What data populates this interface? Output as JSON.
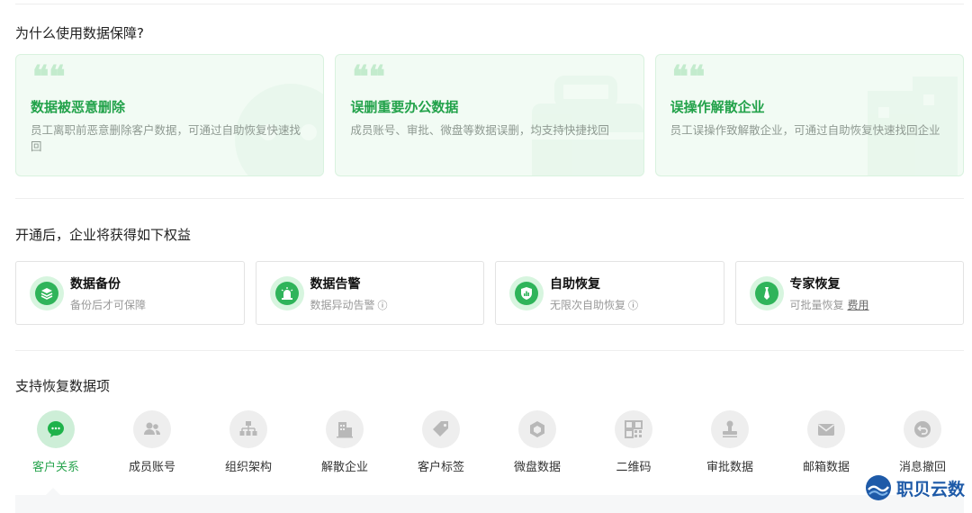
{
  "why": {
    "heading": "为什么使用数据保障?",
    "cards": [
      {
        "title": "数据被恶意删除",
        "desc": "员工离职前恶意删除客户数据，可通过自助恢复快速找回"
      },
      {
        "title": "误删重要办公数据",
        "desc": "成员账号、审批、微盘等数据误删，均支持快捷找回"
      },
      {
        "title": "误操作解散企业",
        "desc": "员工误操作致解散企业，可通过自助恢复快速找回企业"
      }
    ]
  },
  "benefits": {
    "heading": "开通后，企业将获得如下权益",
    "cards": [
      {
        "title": "数据备份",
        "desc": "备份后才可保障",
        "icon": "layers-icon"
      },
      {
        "title": "数据告警",
        "desc": "数据异动告警",
        "icon": "alarm-icon",
        "info": "ⓘ"
      },
      {
        "title": "自助恢复",
        "desc": "无限次自助恢复",
        "icon": "shield-chart-icon",
        "info": "ⓘ"
      },
      {
        "title": "专家恢复",
        "desc": "可批量恢复",
        "icon": "tie-icon",
        "link": "费用"
      }
    ]
  },
  "items": {
    "heading": "支持恢复数据项",
    "list": [
      {
        "label": "客户关系",
        "icon": "chat-bubble-icon",
        "active": true
      },
      {
        "label": "成员账号",
        "icon": "users-icon"
      },
      {
        "label": "组织架构",
        "icon": "org-chart-icon"
      },
      {
        "label": "解散企业",
        "icon": "building-icon"
      },
      {
        "label": "客户标签",
        "icon": "tag-icon"
      },
      {
        "label": "微盘数据",
        "icon": "cube-icon"
      },
      {
        "label": "二维码",
        "icon": "qrcode-icon"
      },
      {
        "label": "审批数据",
        "icon": "stamp-icon"
      },
      {
        "label": "邮箱数据",
        "icon": "mail-icon"
      },
      {
        "label": "消息撤回",
        "icon": "undo-icon"
      }
    ]
  },
  "watermark": {
    "text": "职贝云数"
  },
  "colors": {
    "accent": "#2fb45a",
    "accent_light": "#d7f5df",
    "card_bg": "#f2fbf4",
    "watermark": "#1e5aa8"
  }
}
